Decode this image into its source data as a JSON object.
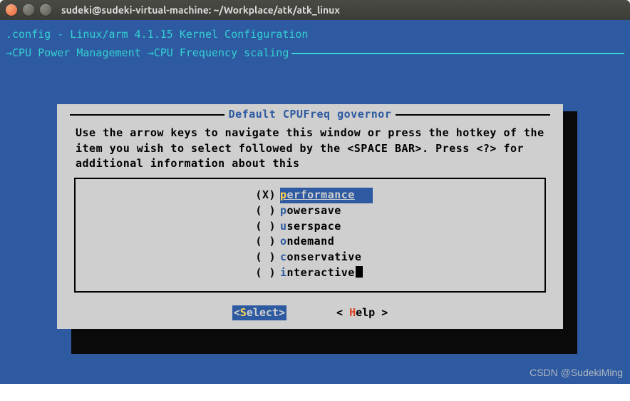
{
  "window": {
    "title": "sudeki@sudeki-virtual-machine: ~/Workplace/atk/atk_linux"
  },
  "header": {
    "config_line": ".config - Linux/arm 4.1.15 Kernel Configuration",
    "crumb1": "CPU Power Management",
    "crumb2": "CPU Frequency scaling"
  },
  "dialog": {
    "title": "Default CPUFreq governor",
    "help_text": "Use the arrow keys to navigate this window or press the hotkey of the item you wish to select followed by the <SPACE BAR>. Press <?> for additional information about this",
    "options": [
      {
        "selected": true,
        "label": "performance"
      },
      {
        "selected": false,
        "label": "powersave"
      },
      {
        "selected": false,
        "label": "userspace"
      },
      {
        "selected": false,
        "label": "ondemand"
      },
      {
        "selected": false,
        "label": "conservative"
      },
      {
        "selected": false,
        "label": "interactive"
      }
    ],
    "buttons": {
      "select": "<Select>",
      "help": "< Help >",
      "select_hotkey": "S",
      "help_hotkey": "H"
    }
  },
  "watermark": "CSDN @SudekiMing"
}
